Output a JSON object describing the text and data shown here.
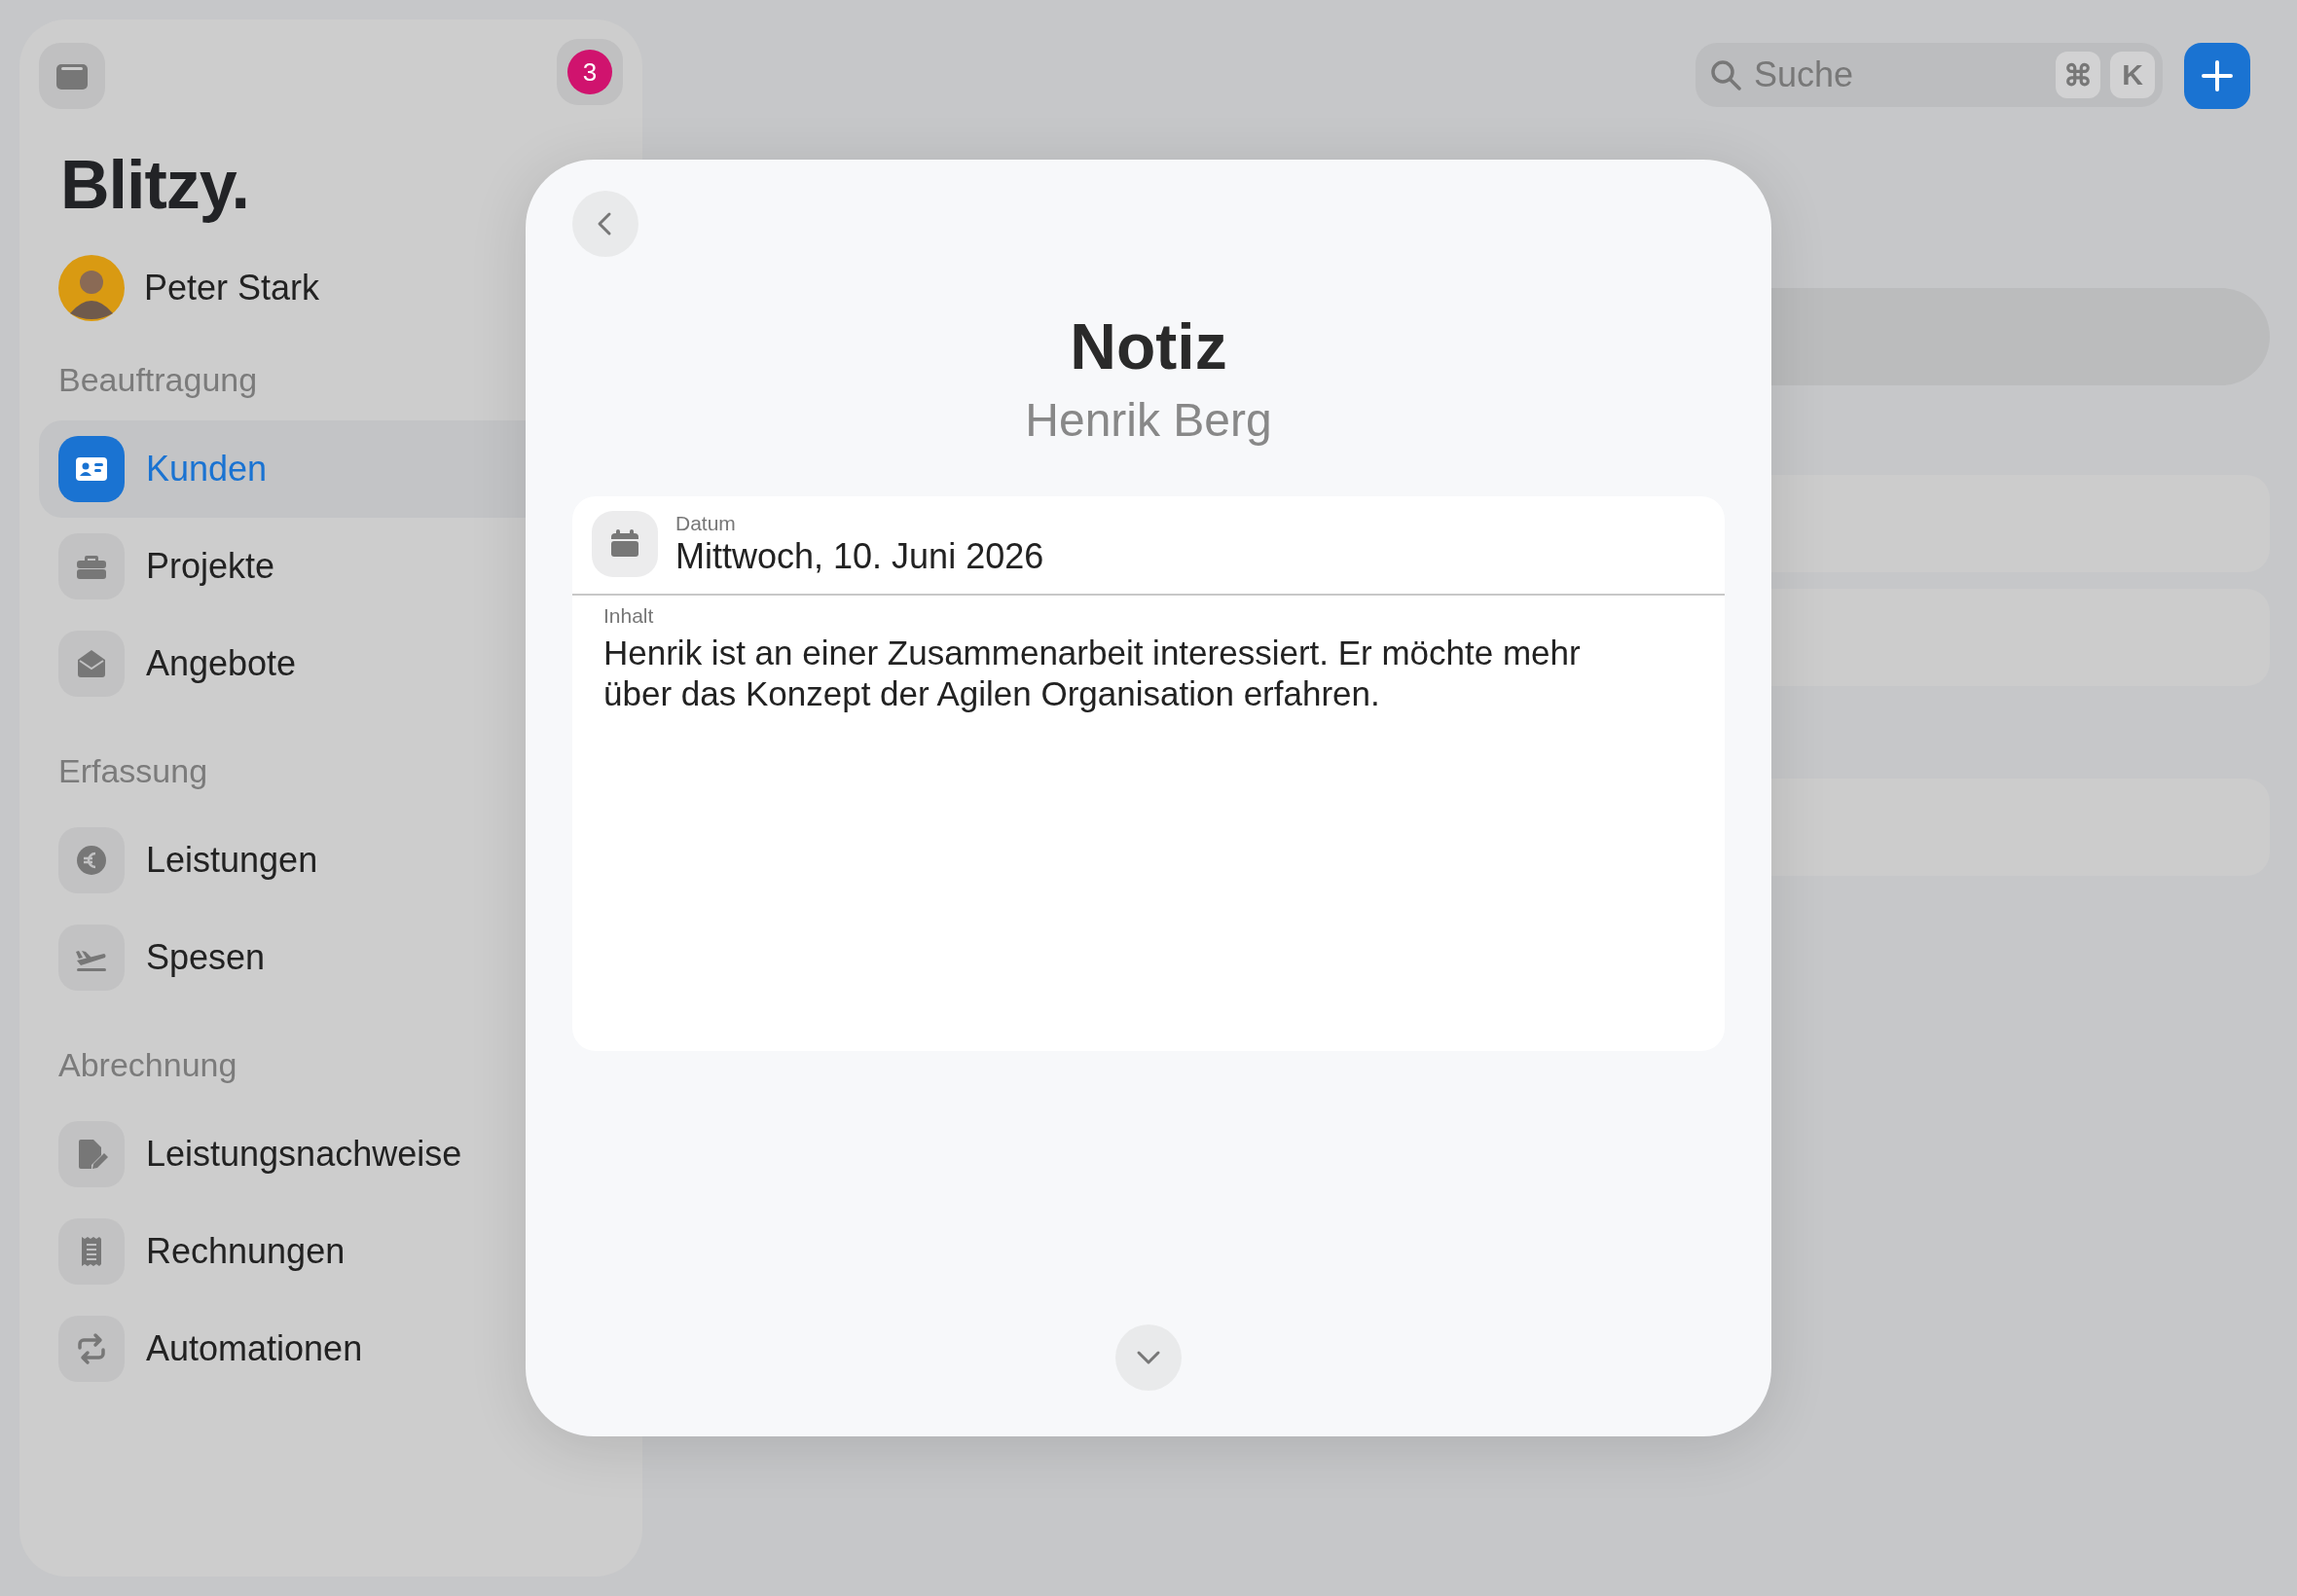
{
  "sidebar": {
    "notification_count": "3",
    "logo": "Blitzy.",
    "user": {
      "name": "Peter Stark"
    },
    "sections": [
      {
        "title": "Beauftragung",
        "items": [
          {
            "label": "Kunden",
            "selected": true
          },
          {
            "label": "Projekte",
            "selected": false
          },
          {
            "label": "Angebote",
            "selected": false
          }
        ]
      },
      {
        "title": "Erfassung",
        "items": [
          {
            "label": "Leistungen",
            "selected": false
          },
          {
            "label": "Spesen",
            "selected": false
          }
        ]
      },
      {
        "title": "Abrechnung",
        "items": [
          {
            "label": "Leistungsnachweise",
            "selected": false
          },
          {
            "label": "Rechnungen",
            "selected": false
          },
          {
            "label": "Automationen",
            "selected": false
          }
        ]
      }
    ]
  },
  "search": {
    "placeholder": "Suche",
    "shortcut_keys": [
      "⌘",
      "K"
    ]
  },
  "dialog": {
    "title": "Notiz",
    "subtitle": "Henrik Berg",
    "fields": [
      {
        "kind": "date",
        "label": "Datum",
        "value": "Mittwoch, 10. Juni 2026"
      },
      {
        "kind": "text",
        "label": "Inhalt",
        "value": "Henrik ist an einer Zusammenarbeit interessiert. Er möchte mehr über das Konzept der Agilen Organisation erfahren."
      }
    ]
  }
}
